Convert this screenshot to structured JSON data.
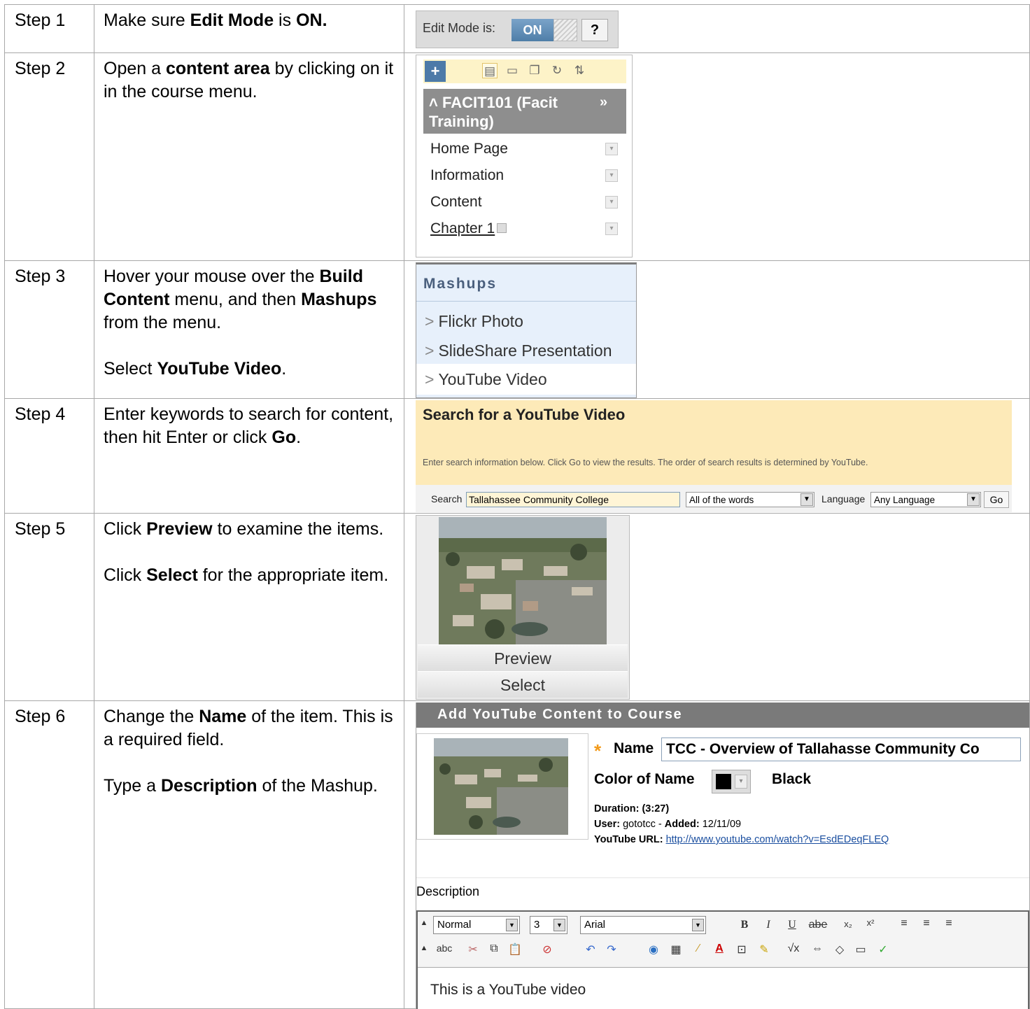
{
  "steps": [
    {
      "label": "Step 1",
      "lines": [
        [
          [
            "Make sure ",
            false
          ],
          [
            "Edit Mode",
            true
          ],
          [
            " is ",
            false
          ],
          [
            "ON.",
            true
          ]
        ]
      ]
    },
    {
      "label": "Step 2",
      "lines": [
        [
          [
            "Open a ",
            false
          ],
          [
            "content area",
            true
          ],
          [
            " by clicking on it in the course menu.",
            false
          ]
        ]
      ]
    },
    {
      "label": "Step 3",
      "lines": [
        [
          [
            "Hover your mouse over the ",
            false
          ],
          [
            "Build Content",
            true
          ],
          [
            " menu, and then ",
            false
          ],
          [
            "Mashups",
            true
          ],
          [
            " from the menu.",
            false
          ]
        ],
        [
          [
            "Select ",
            false
          ],
          [
            "YouTube Video",
            true
          ],
          [
            ".",
            false
          ]
        ]
      ]
    },
    {
      "label": "Step 4",
      "lines": [
        [
          [
            "Enter keywords to search for content, then hit Enter or click ",
            false
          ],
          [
            "Go",
            true
          ],
          [
            ".",
            false
          ]
        ]
      ]
    },
    {
      "label": "Step 5",
      "lines": [
        [
          [
            "Click ",
            false
          ],
          [
            "Preview",
            true
          ],
          [
            " to examine the items.",
            false
          ]
        ],
        [
          [
            "Click ",
            false
          ],
          [
            "Select",
            true
          ],
          [
            " for the appropriate item.",
            false
          ]
        ]
      ]
    },
    {
      "label": "Step 6",
      "lines": [
        [
          [
            "Change the ",
            false
          ],
          [
            "Name",
            true
          ],
          [
            " of the item. This is a required field.",
            false
          ]
        ],
        [
          [
            "Type a ",
            false
          ],
          [
            "Description",
            true
          ],
          [
            " of the Mashup.",
            false
          ]
        ]
      ]
    }
  ],
  "edit_mode": {
    "label": "Edit Mode is:",
    "state": "ON",
    "help": "?"
  },
  "course_menu": {
    "title": "FACIT101 (Facit Training)",
    "collapse_glyph": "»",
    "items": [
      "Home Page",
      "Information",
      "Content",
      "Chapter 1"
    ]
  },
  "mashups": {
    "heading": "Mashups",
    "items": [
      "Flickr Photo",
      "SlideShare Presentation",
      "YouTube Video"
    ]
  },
  "youtube_search": {
    "title": "Search for a YouTube Video",
    "info": "Enter search information below. Click Go to view the results. The order of search results is determined by YouTube.",
    "search_label": "Search",
    "search_value": "Tallahassee Community College",
    "match_value": "All of the words",
    "language_label": "Language",
    "language_value": "Any Language",
    "go": "Go"
  },
  "preview": {
    "preview_label": "Preview",
    "select_label": "Select"
  },
  "add_content": {
    "header": "Add YouTube Content to Course",
    "name_label": "Name",
    "name_value": "TCC - Overview of Tallahasse Community Co",
    "color_label": "Color of Name",
    "color_value": "Black",
    "duration_label": "Duration:",
    "duration_value": "(3:27)",
    "user_label": "User:",
    "user_value": "gototcc",
    "added_label": "Added:",
    "added_value": "12/11/09",
    "url_label": "YouTube URL:",
    "url_value": "http://www.youtube.com/watch?v=EsdEDeqFLEQ",
    "description_label": "Description",
    "editor": {
      "format": "Normal",
      "size": "3",
      "font": "Arial"
    },
    "description_text": "This is a YouTube video"
  },
  "colors": {
    "orange_star": "#f29a1a",
    "on_blue": "#4f7ea8",
    "search_bg": "#fdeab8",
    "link": "#1b4fa0"
  }
}
